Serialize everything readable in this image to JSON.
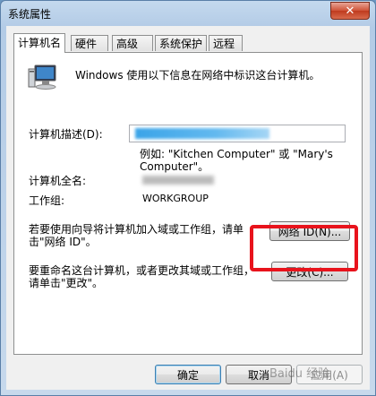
{
  "window": {
    "title": "系统属性",
    "close_symbol": "✕"
  },
  "tabs": [
    "计算机名",
    "硬件",
    "高级",
    "系统保护",
    "远程"
  ],
  "intro_text": "Windows 使用以下信息在网络中标识这台计算机。",
  "description": {
    "label": "计算机描述(D):",
    "example_line1": "例如: \"Kitchen Computer\" 或 \"Mary's",
    "example_line2": "Computer\"。"
  },
  "full_name_label": "计算机全名:",
  "workgroup": {
    "label": "工作组:",
    "value": "WORKGROUP"
  },
  "network_id": {
    "text_line1": "若要使用向导将计算机加入域或工作组，请单",
    "text_line2": "击\"网络 ID\"。",
    "button": "网络 ID(N)..."
  },
  "rename": {
    "text_line1": "要重命名这台计算机，或者更改其域或工作组，",
    "text_line2": "请单击\"更改\"。",
    "button": "更改(C)..."
  },
  "footer": {
    "ok": "确定",
    "cancel": "取消",
    "apply": "应用(A)"
  },
  "watermark": "Baidu 经验"
}
